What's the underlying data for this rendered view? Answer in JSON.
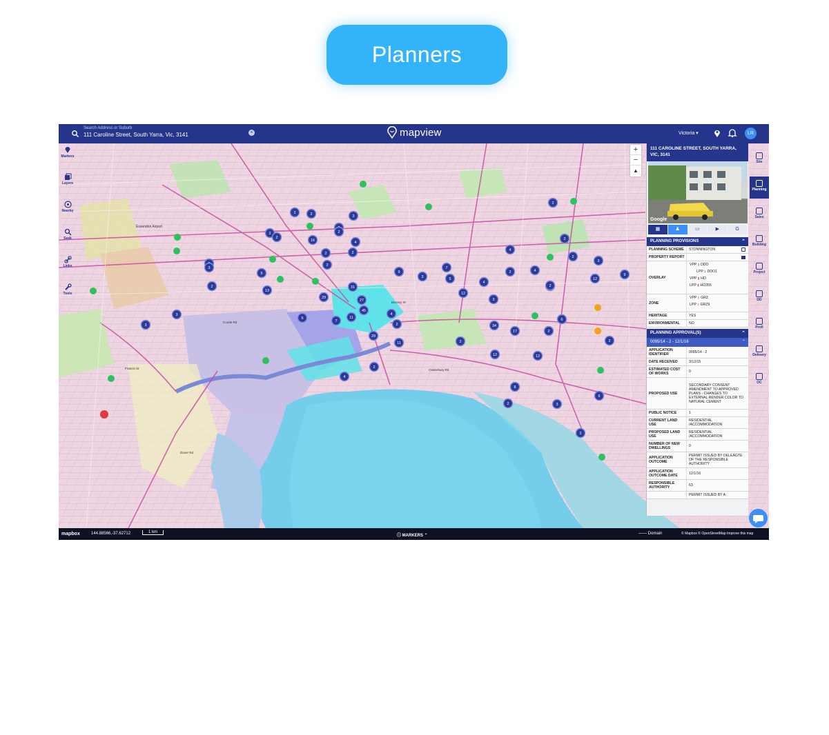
{
  "hero": {
    "title": "Planners"
  },
  "topbar": {
    "search_placeholder": "Search Address or Suburb",
    "search_value": "111 Caroline Street, South Yarra, Vic, 3141",
    "logo": "mapview",
    "region": "Victoria",
    "user_initials": "LR"
  },
  "leftbar": {
    "items": [
      {
        "label": "Markers"
      },
      {
        "label": "Layers"
      },
      {
        "label": "Nearby"
      },
      {
        "label": "Seek"
      },
      {
        "label": "Links"
      },
      {
        "label": "Tools"
      }
    ]
  },
  "rightstrip": {
    "items": [
      {
        "label": "Site"
      },
      {
        "label": "Planning"
      },
      {
        "label": "Sales"
      },
      {
        "label": "Building"
      },
      {
        "label": "Project"
      },
      {
        "label": "DD"
      },
      {
        "label": "Profi"
      },
      {
        "label": "Delivery"
      },
      {
        "label": "OC"
      }
    ]
  },
  "panel": {
    "address": "111 CAROLINE STREET, SOUTH YARRA, VIC, 3141",
    "google_label": "Google",
    "planning_provisions": {
      "heading": "PLANNING PROVISIONS",
      "planning_scheme_label": "PLANNING SCHEME",
      "planning_scheme_value": "STONNINGTON",
      "property_report_label": "PROPERTY REPORT",
      "overlay_label": "OVERLAY",
      "overlays": [
        {
          "type": "VPP",
          "code": "DDO"
        },
        {
          "type": "LPP",
          "code": "DDO1"
        },
        {
          "type": "VPP",
          "code": "HO"
        },
        {
          "type": "LPP",
          "code": "HO355"
        }
      ],
      "zone_label": "ZONE",
      "zones": [
        {
          "type": "VPP",
          "code": "GRZ"
        },
        {
          "type": "LPP",
          "code": "GRZ9"
        }
      ],
      "heritage_label": "HERITAGE",
      "heritage_value": "YES",
      "environmental_label": "ENVIRONMENTAL",
      "environmental_value": "NO"
    },
    "planning_approvals": {
      "heading": "PLANNING APPROVAL(S)",
      "sub_heading": "0095/14 - 2 - 12/1/16",
      "rows": [
        {
          "k": "APPLICATION IDENTIFIER",
          "v": "0095/14 - 2"
        },
        {
          "k": "DATE RECEIVED",
          "v": "3/12/15"
        },
        {
          "k": "ESTIMATED COST OF WORKS",
          "v": "0"
        },
        {
          "k": "PROPOSED USE",
          "v": "SECONDARY CONSENT AMENDMENT TO APPROVED PLANS - CHANGES TO EXTERNAL RENDER COLOR TO NATURAL CEMENT"
        },
        {
          "k": "PUBLIC NOTICE",
          "v": "1"
        },
        {
          "k": "CURRENT LAND USE",
          "v": "RESIDENTIAL /ACCOMMODATION"
        },
        {
          "k": "PROPOSED LAND USE",
          "v": "RESIDENTIAL /ACCOMMODATION"
        },
        {
          "k": "NUMBER OF NEW DWELLINGS",
          "v": "0"
        },
        {
          "k": "APPLICATION OUTCOME",
          "v": "PERMIT ISSUED BY DELEAGTE OF THE RESPONSIBLE AUTHORITY"
        },
        {
          "k": "APPLICATION OUTCOME DATE",
          "v": "12/1/16"
        },
        {
          "k": "RESPONSIBLE AUTHORITY",
          "v": "63"
        },
        {
          "k": "",
          "v": "PERMIT ISSUED BY A"
        }
      ]
    }
  },
  "map": {
    "airport_label": "Essendon Airport",
    "road_labels": [
      "Coode Rd",
      "Francis St",
      "Burnley St",
      "Canterbury Rd",
      "Dover Rd"
    ],
    "clusters": [
      "2",
      "2",
      "3",
      "2",
      "2",
      "16",
      "2",
      "4",
      "2",
      "2",
      "2",
      "3",
      "2",
      "2",
      "2",
      "5",
      "13",
      "31",
      "29",
      "27",
      "45",
      "4",
      "11",
      "2",
      "7",
      "5",
      "29",
      "11",
      "3",
      "3",
      "2",
      "4",
      "9",
      "3",
      "7",
      "5",
      "4",
      "2",
      "4",
      "12",
      "2",
      "12",
      "3",
      "6",
      "34",
      "17",
      "2",
      "2",
      "8",
      "2",
      "3",
      "6",
      "12",
      "12",
      "2",
      "2",
      "4",
      "2",
      "9",
      "2",
      "3",
      "2",
      "2"
    ]
  },
  "bottombar": {
    "mapbox": "mapbox",
    "coords": "144.88566,-37.62712",
    "scale": "1 km",
    "markers": "MARKERS",
    "domain": "Domain",
    "attribution": "© Mapbox © OpenStreetMap Improve this map"
  }
}
